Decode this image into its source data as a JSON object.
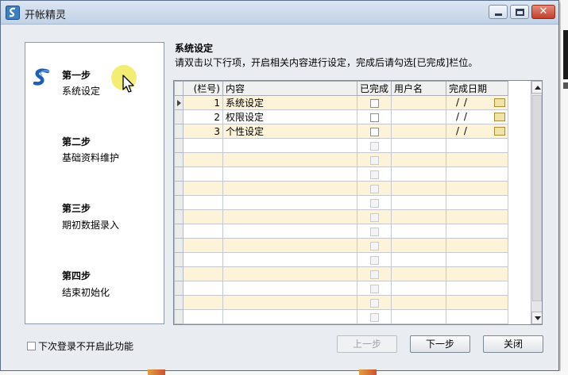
{
  "window": {
    "title": "开帐精灵",
    "close_glyph": "✕"
  },
  "steps": [
    {
      "title": "第一步",
      "subtitle": "系统设定"
    },
    {
      "title": "第二步",
      "subtitle": "基础资料维护"
    },
    {
      "title": "第三步",
      "subtitle": "期初数据录入"
    },
    {
      "title": "第四步",
      "subtitle": "结束初始化"
    }
  ],
  "content": {
    "section_title": "系统设定",
    "instructions": "请双击以下行项，开启相关内容进行设定，完成后请勾选[已完成]栏位。"
  },
  "grid": {
    "headers": {
      "index": "(栏号)",
      "content": "内容",
      "done": "已完成",
      "user": "用户名",
      "date": "完成日期"
    },
    "rows": [
      {
        "index": "1",
        "content": "系统设定",
        "date": "/ /"
      },
      {
        "index": "2",
        "content": "权限设定",
        "date": "/ /"
      },
      {
        "index": "3",
        "content": "个性设定",
        "date": "/ /"
      }
    ],
    "empty_rows": 14
  },
  "footer": {
    "dont_show_label": "下次登录不开启此功能",
    "prev_label": "上一步",
    "next_label": "下一步",
    "close_label": "关闭"
  },
  "icons": {
    "app": "app-logo-icon",
    "step_logo": "s-logo-icon",
    "cursor": "mouse-cursor-icon",
    "calendar": "calendar-icon",
    "row_pointer": "row-pointer-icon"
  },
  "colors": {
    "row_alt": "#fdf3d8",
    "highlight": "#f2ea5a",
    "title_bar": "#c2d2e6",
    "close_button": "#c2402a"
  }
}
